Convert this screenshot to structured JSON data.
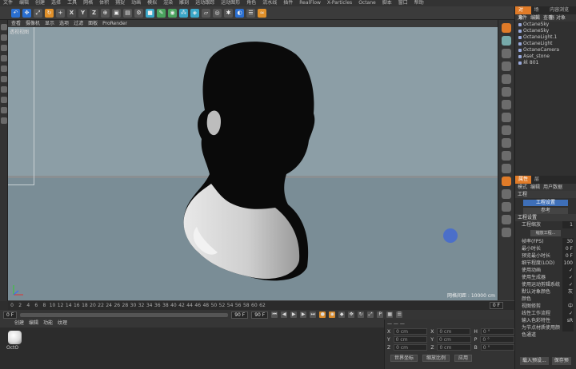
{
  "menubar": [
    "文件",
    "编辑",
    "创建",
    "选择",
    "工具",
    "网格",
    "体积",
    "捕捉",
    "动画",
    "模拟",
    "渲染",
    "雕刻",
    "运动跟踪",
    "运动图形",
    "角色",
    "流水线",
    "插件",
    "RealFlow",
    "X-Particles",
    "Octane",
    "脚本",
    "窗口",
    "帮助"
  ],
  "toolbar": {
    "axes": [
      "X",
      "Y",
      "Z"
    ]
  },
  "viewport": {
    "menu": [
      "查看",
      "摄像机",
      "显示",
      "选项",
      "过滤",
      "面板",
      "ProRender"
    ],
    "label": "透视视图",
    "scale": "网格间距 : 10000 cm"
  },
  "timeline": {
    "ticks": [
      "0",
      "2",
      "4",
      "6",
      "8",
      "10",
      "12",
      "14",
      "16",
      "18",
      "20",
      "22",
      "24",
      "26",
      "28",
      "30",
      "32",
      "34",
      "36",
      "38",
      "40",
      "42",
      "44",
      "46",
      "48",
      "50",
      "52",
      "54",
      "56",
      "58",
      "60",
      "62"
    ],
    "current_frame": "0 F"
  },
  "transport": {
    "start": "0 F",
    "end_a": "90 F",
    "end_b": "90 F"
  },
  "material": {
    "menu": [
      "创建",
      "编辑",
      "功能",
      "纹理"
    ],
    "name": "OctO"
  },
  "coords": {
    "header": "— — —",
    "rows": [
      {
        "a": "X",
        "av": "0 cm",
        "b": "X",
        "bv": "0 cm",
        "c": "H",
        "cv": "0 °"
      },
      {
        "a": "Y",
        "av": "0 cm",
        "b": "Y",
        "bv": "0 cm",
        "c": "P",
        "cv": "0 °"
      },
      {
        "a": "Z",
        "av": "0 cm",
        "b": "Z",
        "bv": "0 cm",
        "c": "B",
        "cv": "0 °"
      }
    ],
    "btn_world": "世界坐标",
    "btn_scale": "缩放比例",
    "btn_apply": "应用"
  },
  "objects": {
    "tabs": [
      "对象",
      "场次",
      "内容浏览器"
    ],
    "menu": [
      "文件",
      "编辑",
      "查看",
      "对象"
    ],
    "items": [
      "OctaneSky",
      "OctaneSky",
      "OctaneLight.1",
      "OctaneLight",
      "OctaneCamera",
      "Aset_stone",
      "丝 801"
    ]
  },
  "attributes": {
    "tabs": [
      "属性",
      "层"
    ],
    "menu": [
      "模式",
      "编辑",
      "用户数据"
    ],
    "section": "工程",
    "btn_settings": "工程设置",
    "btn_ref": "参考",
    "header": "工程设置",
    "rows": [
      {
        "label": "工程缩放",
        "value": "1"
      },
      {
        "label": "帧率(FPS)",
        "value": "30"
      },
      {
        "label": "最小时长",
        "value": "0 F"
      },
      {
        "label": "预览最小时长",
        "value": "0 F"
      },
      {
        "label": "细节程度(LOD)",
        "value": "100"
      },
      {
        "label": "使用动画",
        "value": "✓"
      },
      {
        "label": "使用生成器",
        "value": "✓"
      },
      {
        "label": "使用运动剪辑系统",
        "value": "✓"
      },
      {
        "label": "默认对象颜色",
        "value": "灰"
      },
      {
        "label": "颜色",
        "value": ""
      },
      {
        "label": "视图修剪",
        "value": "中"
      },
      {
        "label": "线性工作流程",
        "value": "✓"
      },
      {
        "label": "输入色彩特性",
        "value": "sR"
      },
      {
        "label": "为节点材质使用颜色通道",
        "value": ""
      }
    ],
    "scale_btn": "缩放工程...",
    "btn_load": "载入预设...",
    "btn_save": "保存预"
  },
  "colors": {
    "accent": "#e07b28",
    "viewport_bg": "#8c9ea6",
    "selection": "#3e6fb8"
  }
}
